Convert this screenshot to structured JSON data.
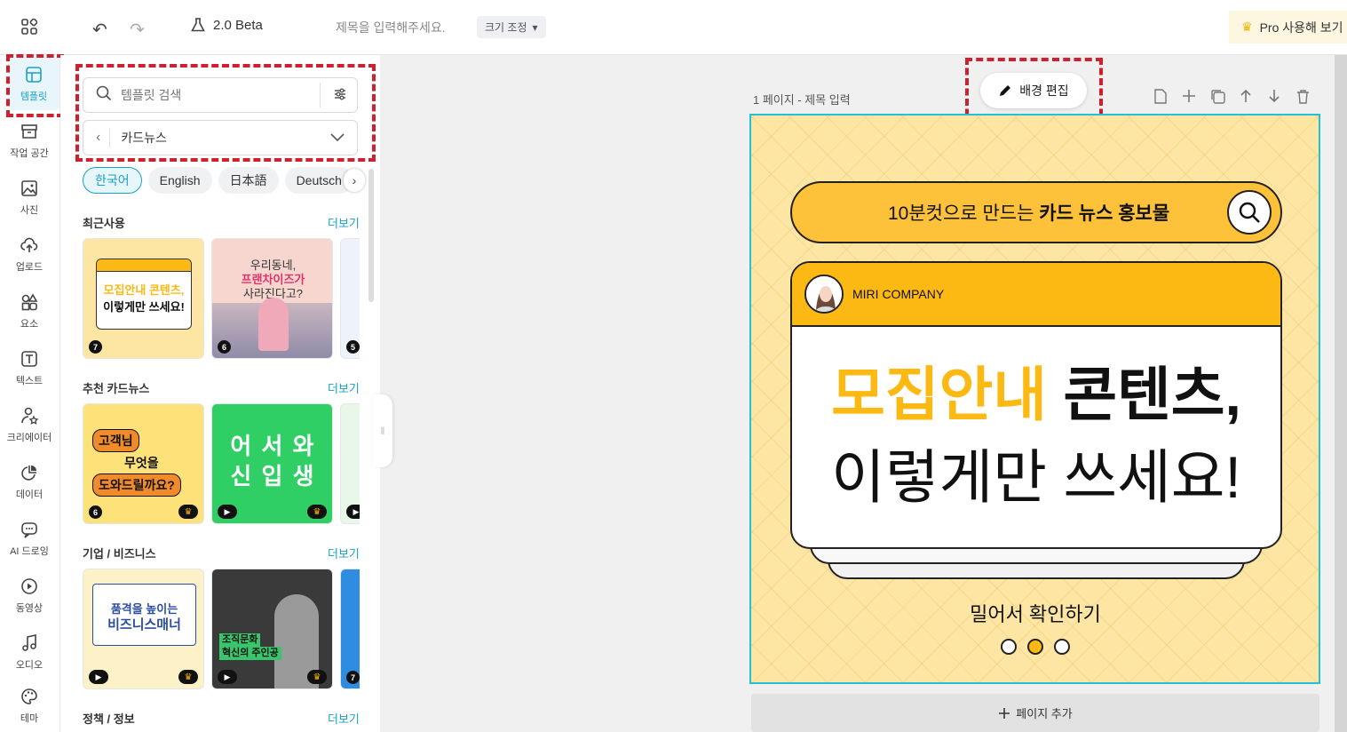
{
  "topbar": {
    "beta_label": "2.0 Beta",
    "title_placeholder": "제목을 입력해주세요.",
    "resize_label": "크기 조정",
    "pro_label": "Pro 사용해 보기",
    "icons": [
      "apps-grid-icon",
      "undo-icon",
      "redo-icon",
      "flask-icon",
      "crown-icon"
    ]
  },
  "rail": {
    "items": [
      {
        "label": "템플릿",
        "icon": "template-icon",
        "active": true
      },
      {
        "label": "작업 공간",
        "icon": "archive-icon"
      },
      {
        "label": "사진",
        "icon": "image-icon"
      },
      {
        "label": "업로드",
        "icon": "upload-cloud-icon"
      },
      {
        "label": "요소",
        "icon": "shapes-icon"
      },
      {
        "label": "텍스트",
        "icon": "text-icon"
      },
      {
        "label": "크리에이터",
        "icon": "creator-star-icon"
      },
      {
        "label": "데이터",
        "icon": "chart-icon"
      },
      {
        "label": "AI 드로잉",
        "icon": "ai-chat-icon"
      },
      {
        "label": "동영상",
        "icon": "play-icon"
      },
      {
        "label": "오디오",
        "icon": "music-note-icon"
      },
      {
        "label": "테마",
        "icon": "palette-icon"
      }
    ]
  },
  "panel": {
    "search_placeholder": "템플릿 검색",
    "category": "카드뉴스",
    "languages": [
      "한국어",
      "English",
      "日本語",
      "Deutsch"
    ],
    "sections": [
      {
        "title": "최근사용",
        "more": "더보기",
        "thumbs": [
          {
            "badge": "7",
            "line1": "모집안내 콘텐츠,",
            "line2": "이렇게만 쓰세요!",
            "bg": "#fde5a3"
          },
          {
            "badge": "6",
            "line1": "우리동네,",
            "line2": "프랜차이즈가",
            "line3": "사라진다고?",
            "bg": "#f7d6d0"
          },
          {
            "badge": "5",
            "bg": "#eef3fb"
          }
        ]
      },
      {
        "title": "추천 카드뉴스",
        "more": "더보기",
        "thumbs": [
          {
            "badge": "6",
            "line1": "고객님",
            "line2": "무엇을",
            "line3": "도와드릴까요?",
            "bg": "#fde27a",
            "crown": true
          },
          {
            "badge": "play",
            "line1": "어 서 와",
            "line2": "신 입 생",
            "bg": "#2fcf66",
            "crown": true
          },
          {
            "badge": "play",
            "bg": "#e8f7e8"
          }
        ]
      },
      {
        "title": "기업 / 비즈니스",
        "more": "더보기",
        "thumbs": [
          {
            "badge": "play",
            "line1": "품격을 높이는",
            "line2": "비즈니스매너",
            "bg": "#fdf1c7",
            "crown": true
          },
          {
            "badge": "play",
            "line1": "조직문화",
            "line2": "혁신의 주인공",
            "bg": "#3a3a3a",
            "crown": true
          },
          {
            "badge": "7",
            "bg": "#2e8de0"
          }
        ]
      },
      {
        "title": "정책 / 정보",
        "more": "더보기"
      }
    ]
  },
  "canvas": {
    "page_label": "1 페이지 - 제목 입력",
    "bg_edit_label": "배경 편집",
    "tools": [
      "page-icon",
      "plus-icon",
      "duplicate-icon",
      "arrow-up-icon",
      "arrow-down-icon",
      "trash-icon"
    ],
    "pill_text_prefix": "10분컷으로 만드는 ",
    "pill_text_bold": "카드 뉴스 홍보물",
    "company": "MIRI COMPANY",
    "headline_highlight": "모집안내",
    "headline_rest": " 콘텐츠,",
    "headline_line2": "이렇게만 쓰세요!",
    "swipe_text": "밀어서 확인하기",
    "dots": 3,
    "active_dot": 1,
    "accent": "#fdb913",
    "selection_color": "#22c1d6"
  },
  "add_page_label": "페이지 추가"
}
